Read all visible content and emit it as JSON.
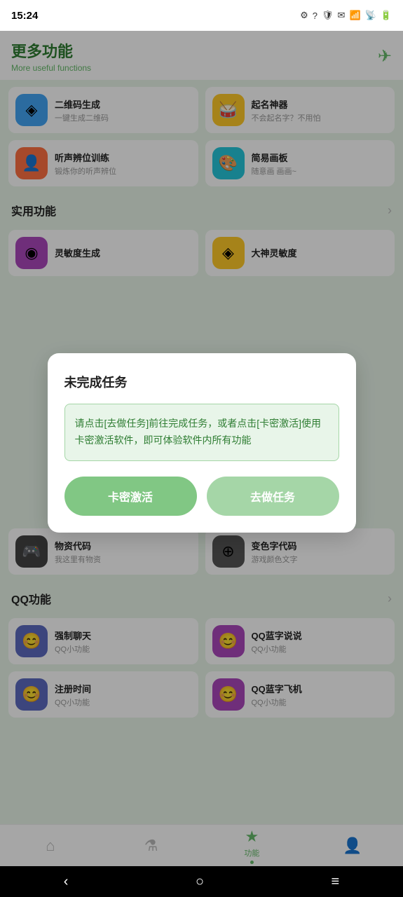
{
  "statusBar": {
    "time": "15:24",
    "icons": [
      "⚙",
      "?",
      "🛡",
      "✉"
    ]
  },
  "header": {
    "title": "更多功能",
    "subtitle": "More useful functions",
    "icon": "✈"
  },
  "features": [
    {
      "name": "二维码生成",
      "desc": "一键生成二维码",
      "icon": "🔵",
      "iconClass": "icon-blue"
    },
    {
      "name": "起名神器",
      "desc": "不会起名字？不用怕",
      "icon": "🥁",
      "iconClass": "icon-yellow"
    },
    {
      "name": "听声辨位训练",
      "desc": "锻炼你的听声辨位",
      "icon": "👤",
      "iconClass": "icon-orange"
    },
    {
      "name": "简易画板",
      "desc": "随意画 画画~",
      "icon": "🎨",
      "iconClass": "icon-teal"
    }
  ],
  "practicalSection": {
    "title": "实用功能",
    "items": [
      {
        "name": "灵敏度生成",
        "desc": "",
        "iconClass": "icon-purple"
      },
      {
        "name": "大神灵敏度",
        "desc": "",
        "iconClass": "icon-yellow"
      }
    ]
  },
  "dialog": {
    "title": "未完成任务",
    "message": "请点击[去做任务]前往完成任务，或者点击[卡密激活]使用卡密激活软件，即可体验软件内所有功能",
    "btn1": "卡密激活",
    "btn2": "去做任务"
  },
  "moreItems": [
    {
      "name": "物资代码",
      "desc": "我这里有物资",
      "iconClass": "icon-dark"
    },
    {
      "name": "变色字代码",
      "desc": "游戏颜色文字",
      "iconClass": "icon-dark"
    }
  ],
  "qqSection": {
    "title": "QQ功能",
    "items": [
      {
        "name": "强制聊天",
        "desc": "QQ小功能",
        "iconClass": "icon-indigo"
      },
      {
        "name": "QQ蓝字说说",
        "desc": "QQ小功能",
        "iconClass": "icon-purple"
      },
      {
        "name": "注册时间",
        "desc": "QQ小功能",
        "iconClass": "icon-indigo"
      },
      {
        "name": "QQ蓝字飞机",
        "desc": "QQ小功能",
        "iconClass": "icon-purple"
      }
    ]
  },
  "bottomNav": {
    "items": [
      {
        "icon": "⌂",
        "label": "",
        "active": false
      },
      {
        "icon": "⚗",
        "label": "",
        "active": false
      },
      {
        "icon": "★",
        "label": "功能",
        "active": true
      },
      {
        "icon": "👤",
        "label": "",
        "active": false
      }
    ]
  },
  "androidNav": {
    "back": "‹",
    "home": "○",
    "menu": "≡"
  }
}
